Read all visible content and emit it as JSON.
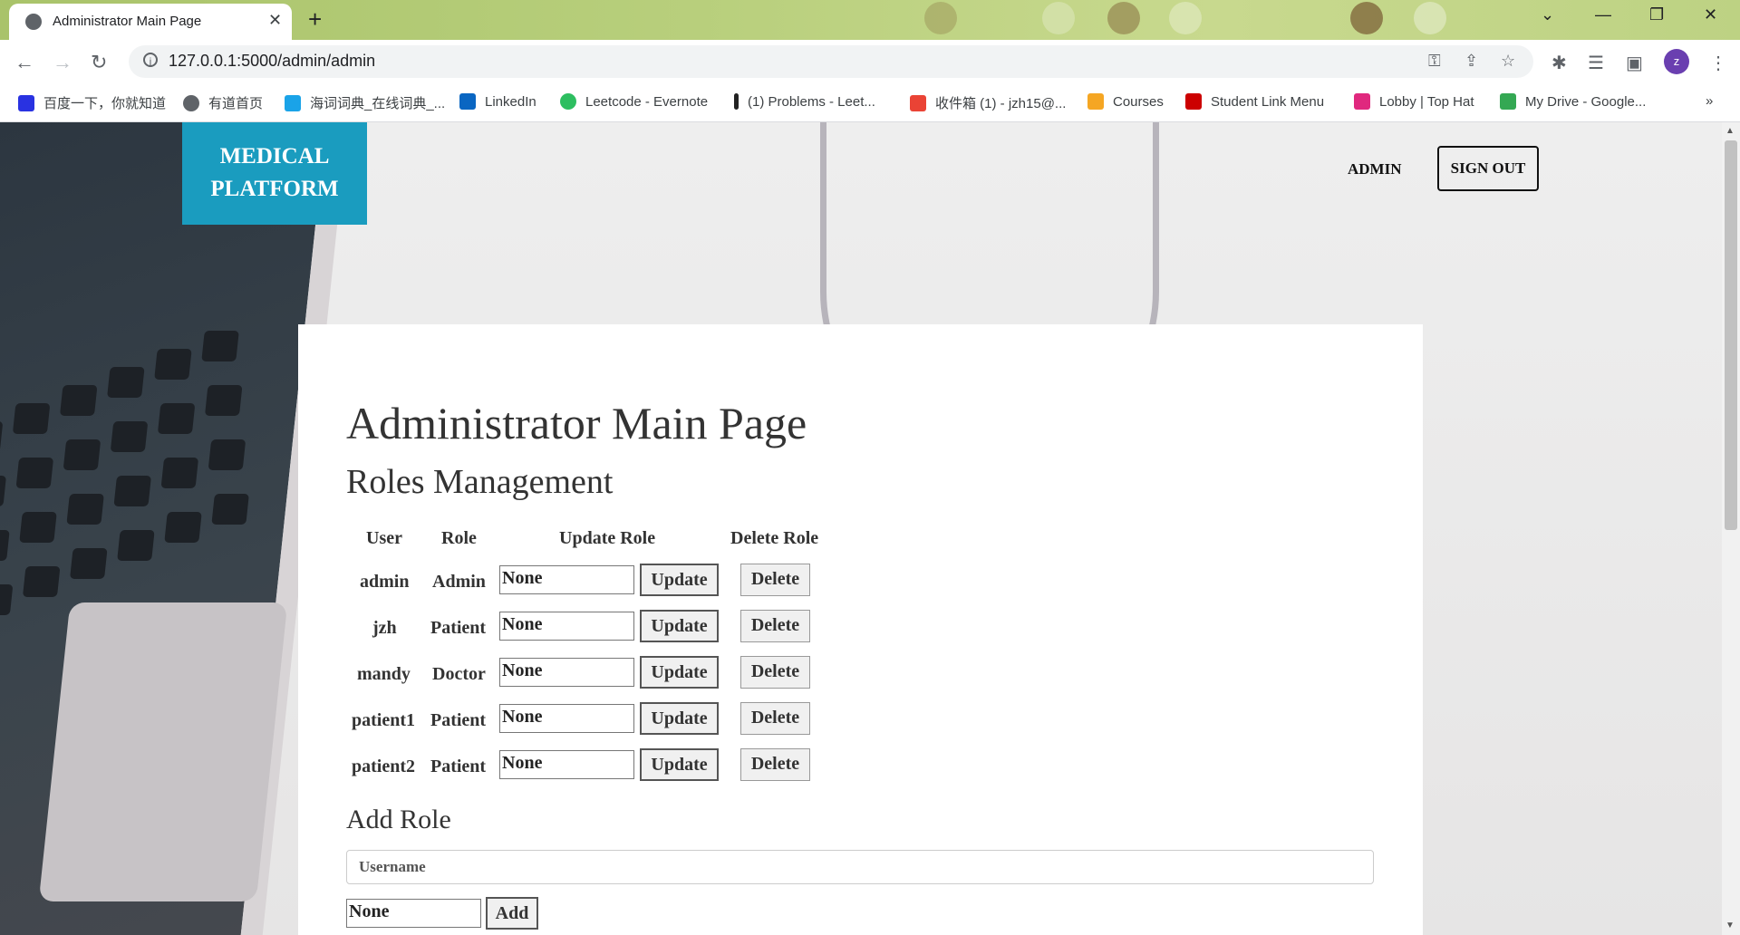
{
  "browser": {
    "tab_title": "Administrator Main Page",
    "tab_close": "✕",
    "new_tab": "+",
    "url": "127.0.0.1:5000/admin/admin",
    "avatar_letter": "z",
    "bookmarks": [
      {
        "label": "百度一下，你就知道",
        "color": "#2932e1"
      },
      {
        "label": "有道首页",
        "color": "#5f6368"
      },
      {
        "label": "海词词典_在线词典_...",
        "color": "#1aa3e8"
      },
      {
        "label": "LinkedIn",
        "color": "#0a66c2"
      },
      {
        "label": "Leetcode - Evernote",
        "color": "#2dbe60"
      },
      {
        "label": "(1) Problems - Leet...",
        "color": "#222222"
      },
      {
        "label": "收件箱 (1) - jzh15@...",
        "color": "#ea4335"
      },
      {
        "label": "Courses",
        "color": "#f5a623"
      },
      {
        "label": "Student Link Menu",
        "color": "#cc0000"
      },
      {
        "label": "Lobby | Top Hat",
        "color": "#e0287e"
      },
      {
        "label": "My Drive - Google...",
        "color": "#34a853"
      }
    ],
    "bookmarks_more": "»"
  },
  "header": {
    "logo_line1": "MEDICAL",
    "logo_line2": "PLATFORM",
    "admin_link": "ADMIN",
    "signout_button": "SIGN OUT"
  },
  "main": {
    "title": "Administrator Main Page",
    "roles_heading": "Roles Management",
    "columns": [
      "User",
      "Role",
      "Update Role",
      "Delete Role"
    ],
    "rows": [
      {
        "user": "admin",
        "role": "Admin",
        "value": "None",
        "update": "Update",
        "delete": "Delete"
      },
      {
        "user": "jzh",
        "role": "Patient",
        "value": "None",
        "update": "Update",
        "delete": "Delete"
      },
      {
        "user": "mandy",
        "role": "Doctor",
        "value": "None",
        "update": "Update",
        "delete": "Delete"
      },
      {
        "user": "patient1",
        "role": "Patient",
        "value": "None",
        "update": "Update",
        "delete": "Delete"
      },
      {
        "user": "patient2",
        "role": "Patient",
        "value": "None",
        "update": "Update",
        "delete": "Delete"
      }
    ],
    "add_heading": "Add Role",
    "username_placeholder": "Username",
    "add_value": "None",
    "add_button": "Add"
  }
}
